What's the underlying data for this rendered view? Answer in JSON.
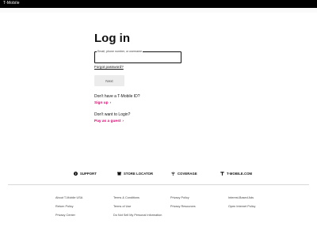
{
  "topbar": {
    "brand": "T-Mobile"
  },
  "login": {
    "title": "Log in",
    "field_legend": "Email, phone number, or username",
    "field_value": "",
    "forgot": "Forgot password?",
    "next_button": "Next",
    "signup_question": "Don't have a T-Mobile ID?",
    "signup_link": "Sign up",
    "guest_question": "Don't want to Login?",
    "guest_link": "Pay as a guest"
  },
  "help_links": [
    {
      "label": "SUPPORT",
      "icon": "question-circle-icon"
    },
    {
      "label": "STORE LOCATOR",
      "icon": "store-icon"
    },
    {
      "label": "COVERAGE",
      "icon": "signal-icon"
    },
    {
      "label": "T-MOBILE.COM",
      "icon": "t-logo-icon"
    }
  ],
  "footer": {
    "col1": [
      "About T-Mobile USA",
      "Return Policy",
      "Privacy Center"
    ],
    "col2": [
      "Terms & Conditions",
      "Terms of Use",
      "Do Not Sell My Personal Information"
    ],
    "col3": [
      "Privacy Policy",
      "Privacy Resources"
    ],
    "col4": [
      "Interest-Based Ads",
      "Open Internet Policy"
    ]
  },
  "colors": {
    "accent": "#e20074",
    "topbar": "#000000"
  }
}
